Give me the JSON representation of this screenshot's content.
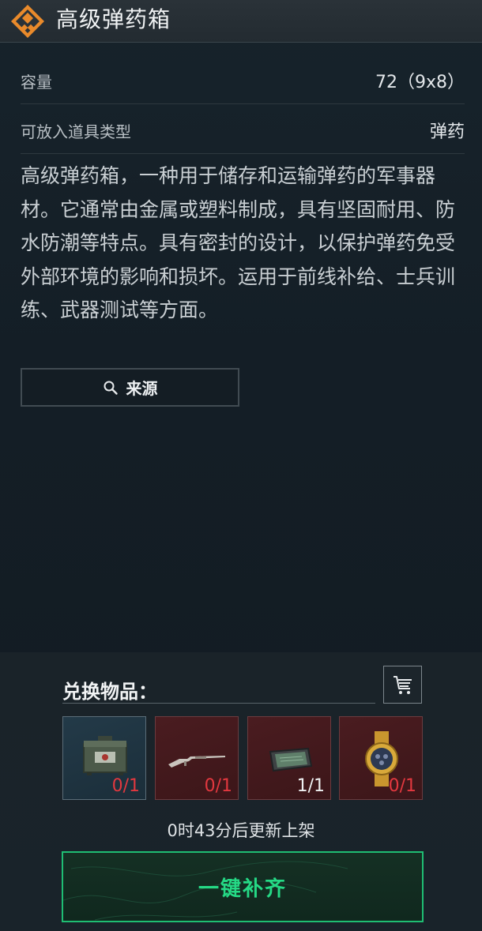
{
  "header": {
    "title": "高级弹药箱",
    "icon": "ammo-box-category-icon"
  },
  "attributes": [
    {
      "key": "容量",
      "value": "72（9x8）"
    },
    {
      "key": "可放入道具类型",
      "value": "弹药"
    }
  ],
  "description": "高级弹药箱，一种用于储存和运输弹药的军事器材。它通常由金属或塑料制成，具有坚固耐用、防水防潮等特点。具有密封的设计，以保护弹药免受外部环境的影响和损坏。运用于前线补给、士兵训练、武器测试等方面。",
  "source_button": {
    "label": "来源",
    "icon": "search-icon"
  },
  "exchange": {
    "title": "兑换物品：",
    "cart_icon": "cart-icon",
    "items": [
      {
        "name": "ammo-box",
        "count": "0/1",
        "status": "missing"
      },
      {
        "name": "rifle",
        "count": "0/1",
        "status": "missing"
      },
      {
        "name": "tablet-device",
        "count": "1/1",
        "status": "complete"
      },
      {
        "name": "gold-watch",
        "count": "0/1",
        "status": "missing"
      }
    ],
    "restock_text": "0时43分后更新上架",
    "fill_button_label": "一键补齐"
  },
  "colors": {
    "accent_green": "#25d985",
    "missing_red": "#e2383f",
    "brand_orange": "#e98a2b"
  }
}
